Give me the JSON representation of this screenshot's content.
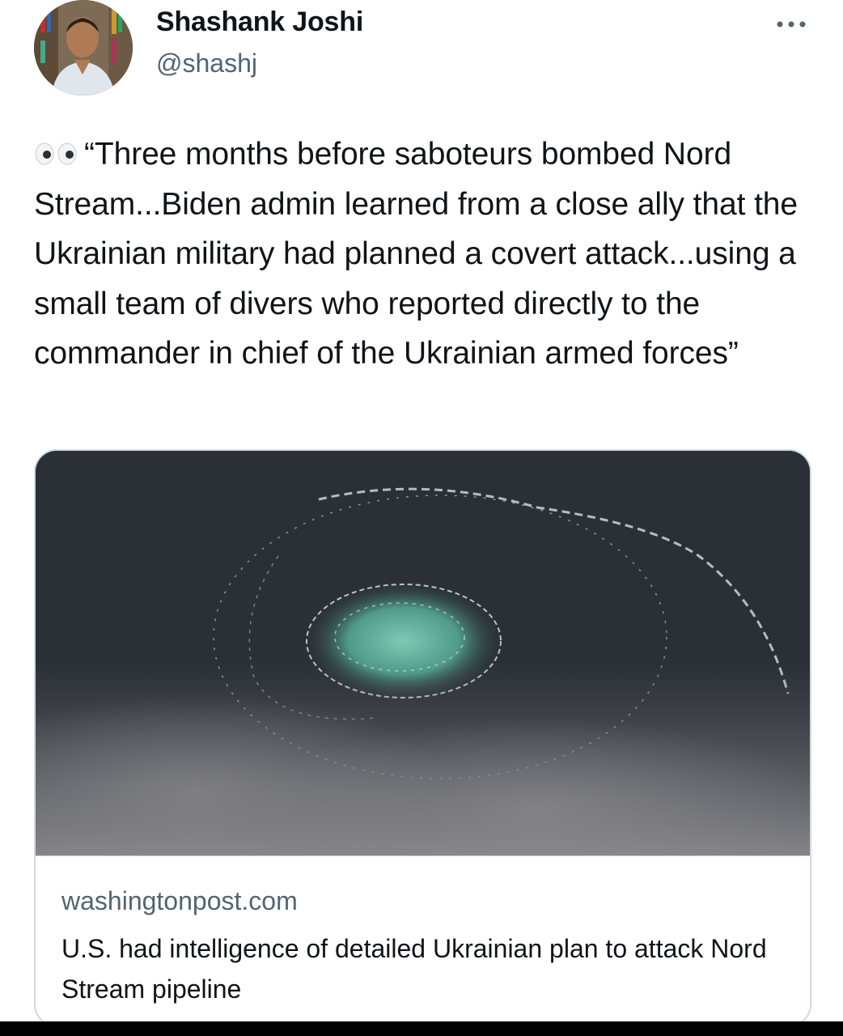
{
  "tweet": {
    "author": {
      "name": "Shashank Joshi",
      "handle": "@shashj",
      "avatar_icon": "profile-photo"
    },
    "more_icon": "ellipsis-icon",
    "emoji": "eyes-emoji",
    "text": "“Three months before saboteurs bombed Nord Stream...Biden admin learned from a close ally that the Ukrainian military had planned a covert attack...using a small team of divers who reported directly to the commander in chief of the Ukrainian armed forces”",
    "link_card": {
      "domain": "washingtonpost.com",
      "title": "U.S. had intelligence of detailed Ukrainian plan to attack Nord Stream pipeline",
      "image_icon": "sea-gas-leak-photo"
    }
  },
  "colors": {
    "text_primary": "#0f1419",
    "text_secondary": "#536471",
    "border": "#cfd9de"
  }
}
